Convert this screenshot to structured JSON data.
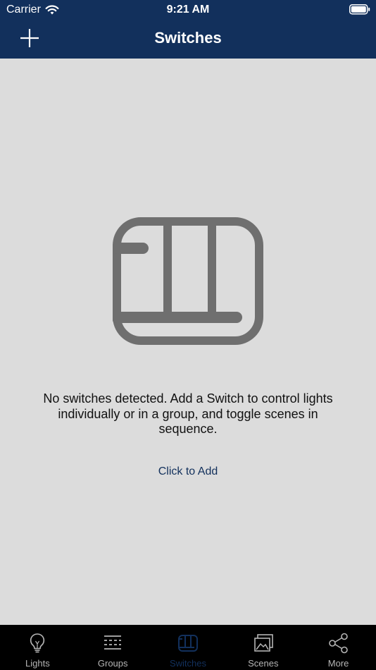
{
  "status_bar": {
    "carrier": "Carrier",
    "time": "9:21 AM"
  },
  "nav": {
    "title": "Switches"
  },
  "empty_state": {
    "message": "No switches detected. Add a Switch to control lights individually or in a group, and toggle scenes in sequence.",
    "action": "Click to Add"
  },
  "tabs": [
    {
      "label": "Lights",
      "icon": "bulb-icon"
    },
    {
      "label": "Groups",
      "icon": "groups-icon"
    },
    {
      "label": "Switches",
      "icon": "switch-icon",
      "active": true
    },
    {
      "label": "Scenes",
      "icon": "scenes-icon"
    },
    {
      "label": "More",
      "icon": "share-icon"
    }
  ],
  "colors": {
    "header": "#12305c",
    "background": "#dcdcdc",
    "illustration": "#6f6f6f",
    "tab_inactive": "#b5b5b5",
    "tab_active": "#12305c"
  }
}
